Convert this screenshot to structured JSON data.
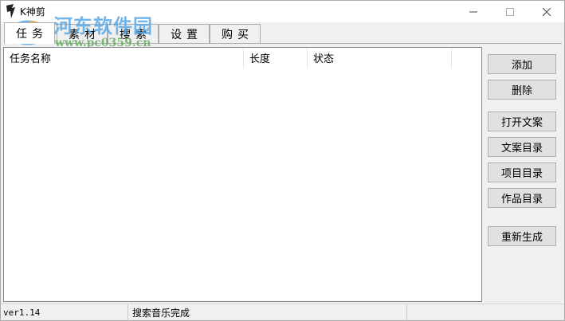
{
  "window": {
    "title": "K神剪",
    "controls": {
      "minimize": "─",
      "maximize": "☐",
      "close": "✕"
    }
  },
  "watermark": {
    "title": "河东软件园",
    "url": "www.pc0359.cn",
    "colors": {
      "title": "#5aa9e6",
      "url": "#6fb06a"
    }
  },
  "tabs": [
    {
      "label": "任务"
    },
    {
      "label": "素材"
    },
    {
      "label": "搜索"
    },
    {
      "label": "设置"
    },
    {
      "label": "购买"
    }
  ],
  "task_list": {
    "columns": [
      {
        "label": "任务名称"
      },
      {
        "label": "长度"
      },
      {
        "label": "状态"
      }
    ],
    "rows": []
  },
  "actions": {
    "add": "添加",
    "delete": "删除",
    "open_copy": "打开文案",
    "copy_dir": "文案目录",
    "project_dir": "项目目录",
    "works_dir": "作品目录",
    "regenerate": "重新生成"
  },
  "statusbar": {
    "version": "ver1.14",
    "message": "搜索音乐完成",
    "extra": ""
  }
}
